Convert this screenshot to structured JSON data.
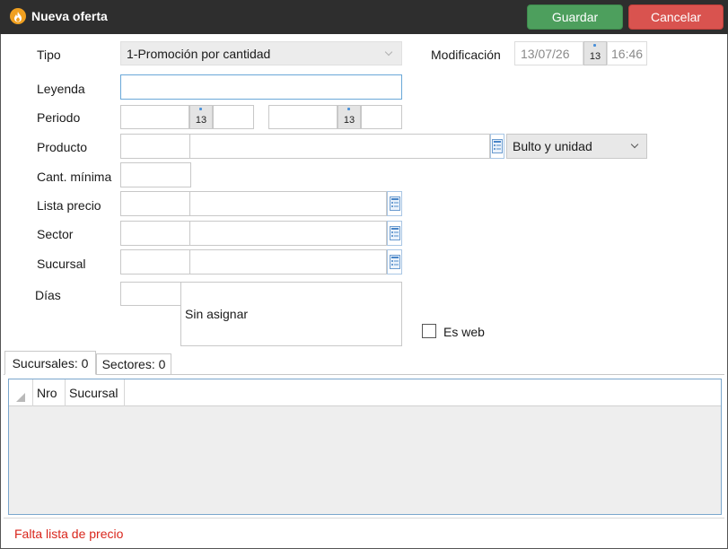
{
  "window": {
    "title": "Nueva oferta"
  },
  "toolbar": {
    "save_label": "Guardar",
    "cancel_label": "Cancelar"
  },
  "form": {
    "tipo": {
      "label": "Tipo",
      "value": "1-Promoción por cantidad"
    },
    "modificacion": {
      "label": "Modificación",
      "date": "13/07/26",
      "time": "16:46",
      "calendar_day": "13"
    },
    "leyenda": {
      "label": "Leyenda",
      "value": ""
    },
    "periodo": {
      "label": "Periodo",
      "from_day": "13",
      "to_day": "13"
    },
    "producto": {
      "label": "Producto",
      "unit_option": "Bulto y unidad"
    },
    "cant_minima": {
      "label": "Cant. mínima"
    },
    "lista_precio": {
      "label": "Lista precio"
    },
    "sector": {
      "label": "Sector"
    },
    "sucursal": {
      "label": "Sucursal"
    },
    "dias": {
      "label": "Días",
      "value": "Sin asignar"
    },
    "es_web": {
      "label": "Es web",
      "checked": false
    }
  },
  "tabs": [
    {
      "label": "Sucursales: 0",
      "active": true
    },
    {
      "label": "Sectores: 0",
      "active": false
    }
  ],
  "grid": {
    "columns": [
      "Nro",
      "Sucursal"
    ]
  },
  "status": {
    "message": "Falta lista de precio",
    "color": "#d9261c"
  },
  "colors": {
    "save": "#4d9f5d",
    "cancel": "#d9534f",
    "titlebar": "#2e2e2e"
  },
  "icons": {
    "app": "flame-icon",
    "calendar": "calendar-icon",
    "lookup": "list-lookup-icon",
    "dropdown": "chevron-down-icon"
  }
}
